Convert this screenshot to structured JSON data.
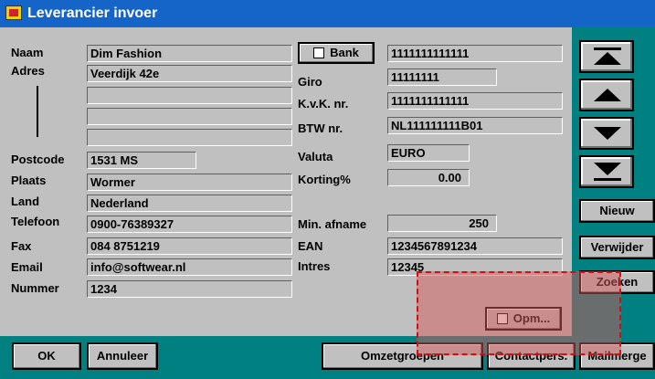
{
  "window": {
    "title": "Leverancier invoer"
  },
  "labels": {
    "naam": "Naam",
    "adres": "Adres",
    "postcode": "Postcode",
    "plaats": "Plaats",
    "land": "Land",
    "telefoon": "Telefoon",
    "fax": "Fax",
    "email": "Email",
    "nummer": "Nummer",
    "giro": "Giro",
    "kvk": "K.v.K. nr.",
    "btw": "BTW nr.",
    "valuta": "Valuta",
    "korting": "Korting%",
    "min_afname": "Min. afname",
    "ean": "EAN",
    "intres": "Intres"
  },
  "values": {
    "naam": "Dim Fashion",
    "adres1": "Veerdijk 42e",
    "adres2": "",
    "adres3": "",
    "adres4": "",
    "postcode": "1531 MS",
    "plaats": "Wormer",
    "land": "Nederland",
    "telefoon": "0900-76389327",
    "fax": "084 8751219",
    "email": "info@softwear.nl",
    "nummer": "1234",
    "bank": "1111111111111",
    "giro": "11111111",
    "kvk": "1111111111111",
    "btw": "NL111111111B01",
    "valuta": "EURO",
    "korting": "0.00",
    "min_afname": "250",
    "ean": "1234567891234",
    "intres": "12345"
  },
  "buttons": {
    "bank": "Bank",
    "opm": "Opm...",
    "nieuw": "Nieuw",
    "verwijder": "Verwijder",
    "zoeken": "Zoeken",
    "ok": "OK",
    "annuleer": "Annuleer",
    "omzetgroepen": "Omzetgroepen",
    "contactpers": "Contactpers.",
    "mailmerge": "Mailmerge"
  },
  "colors": {
    "titlebar": "#1565c9",
    "panel": "#008080",
    "face": "#c0c0c0"
  }
}
